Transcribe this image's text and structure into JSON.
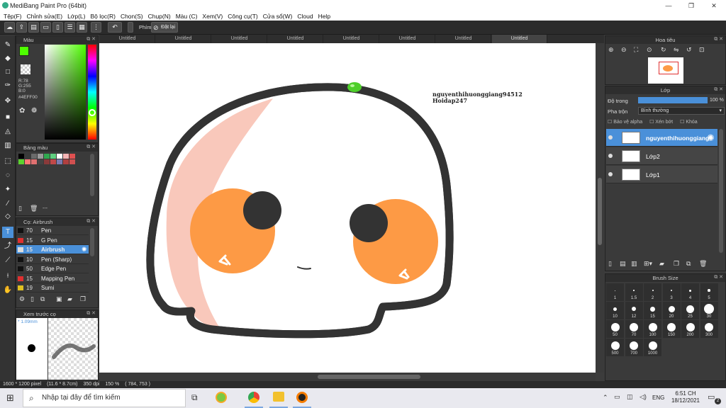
{
  "window": {
    "title": "MediBang Paint Pro (64bit)",
    "minimize": "—",
    "maximize": "❐",
    "close": "✕"
  },
  "menu": [
    "Tệp(F)",
    "Chỉnh sửa(E)",
    "Lớp(L)",
    "Bộ lọc(R)",
    "Chọn(S)",
    "Chụp(N)",
    "Màu (C)",
    "Xem(V)",
    "Công cụ(T)",
    "Cửa sổ(W)",
    "Cloud",
    "Help"
  ],
  "toolbar": {
    "key_label": "Phím",
    "reset_label": "Đặt lại"
  },
  "color_panel": {
    "title": "Màu",
    "r": "R:78",
    "g": "G:255",
    "b": "B:0",
    "hex": "#4EFF00",
    "foreground": "#4EFF00"
  },
  "palette": {
    "title": "Bảng màu",
    "footer": "---",
    "colors": [
      "#000000",
      "#3a3a3a",
      "#6b6b6b",
      "#9a9a9a",
      "#2fa84f",
      "#5fcf7f",
      "#ffffff",
      "#f4b3b3",
      "#e05050",
      "#5bd12e",
      "#ff7777",
      "#e07070",
      "#444444",
      "#8a3a3a",
      "#c04848",
      "#7a7ab0",
      "#b04040",
      "#d05050"
    ]
  },
  "brush_panel": {
    "title": "Cọ: Airbrush",
    "items": [
      {
        "size": "70",
        "name": "Pen",
        "color": "#111111"
      },
      {
        "size": "15",
        "name": "G Pen",
        "color": "#e03030"
      },
      {
        "size": "15",
        "name": "Airbrush",
        "color": "#dddddd"
      },
      {
        "size": "10",
        "name": "Pen (Sharp)",
        "color": "#111111"
      },
      {
        "size": "50",
        "name": "Edge Pen",
        "color": "#111111"
      },
      {
        "size": "15",
        "name": "Mapping Pen",
        "color": "#e03030"
      },
      {
        "size": "19",
        "name": "Sumi",
        "color": "#e0c020"
      }
    ]
  },
  "preview_panel": {
    "title": "Xem trước cọ",
    "size": "* 1.09mm"
  },
  "tabs": [
    "Untitled",
    "Untitled",
    "Untitled",
    "Untitled",
    "Untitled",
    "Untitled",
    "Untitled",
    "Untitled"
  ],
  "canvas": {
    "watermark_line1": "nguyenthihuonggiang94512",
    "watermark_line2": "Hoidap247"
  },
  "navigator": {
    "title": "Hoa tiêu"
  },
  "layer_panel": {
    "title": "Lớp",
    "opacity_label": "Độ trong",
    "opacity_value": "100 %",
    "opacity_fraction": 1.0,
    "blend_label": "Pha trộn",
    "blend_value": "Bình thường",
    "protect_alpha": "Bảo vệ alpha",
    "clipping": "Xén bớt",
    "lock": "Khóa",
    "layers": [
      "nguyenthihuonggiang",
      "Lớp2",
      "Lớp1"
    ]
  },
  "brush_size": {
    "title": "Brush Size",
    "sizes": [
      "1",
      "1.5",
      "2",
      "3",
      "4",
      "5",
      "10",
      "12",
      "15",
      "20",
      "25",
      "30",
      "50",
      "70",
      "100",
      "150",
      "200",
      "300",
      "500",
      "700",
      "1000"
    ]
  },
  "status": {
    "pixels": "1600 * 1200 pixel",
    "physical": "(11.6 * 8.7cm)",
    "dpi": "350 dpi",
    "zoom": "150 %",
    "coords": "( 784, 753 )"
  },
  "taskbar": {
    "search_placeholder": "Nhập tại đây để tìm kiếm",
    "lang": "ENG",
    "time": "6:51 CH",
    "date": "18/12/2021",
    "notif_count": "2"
  }
}
